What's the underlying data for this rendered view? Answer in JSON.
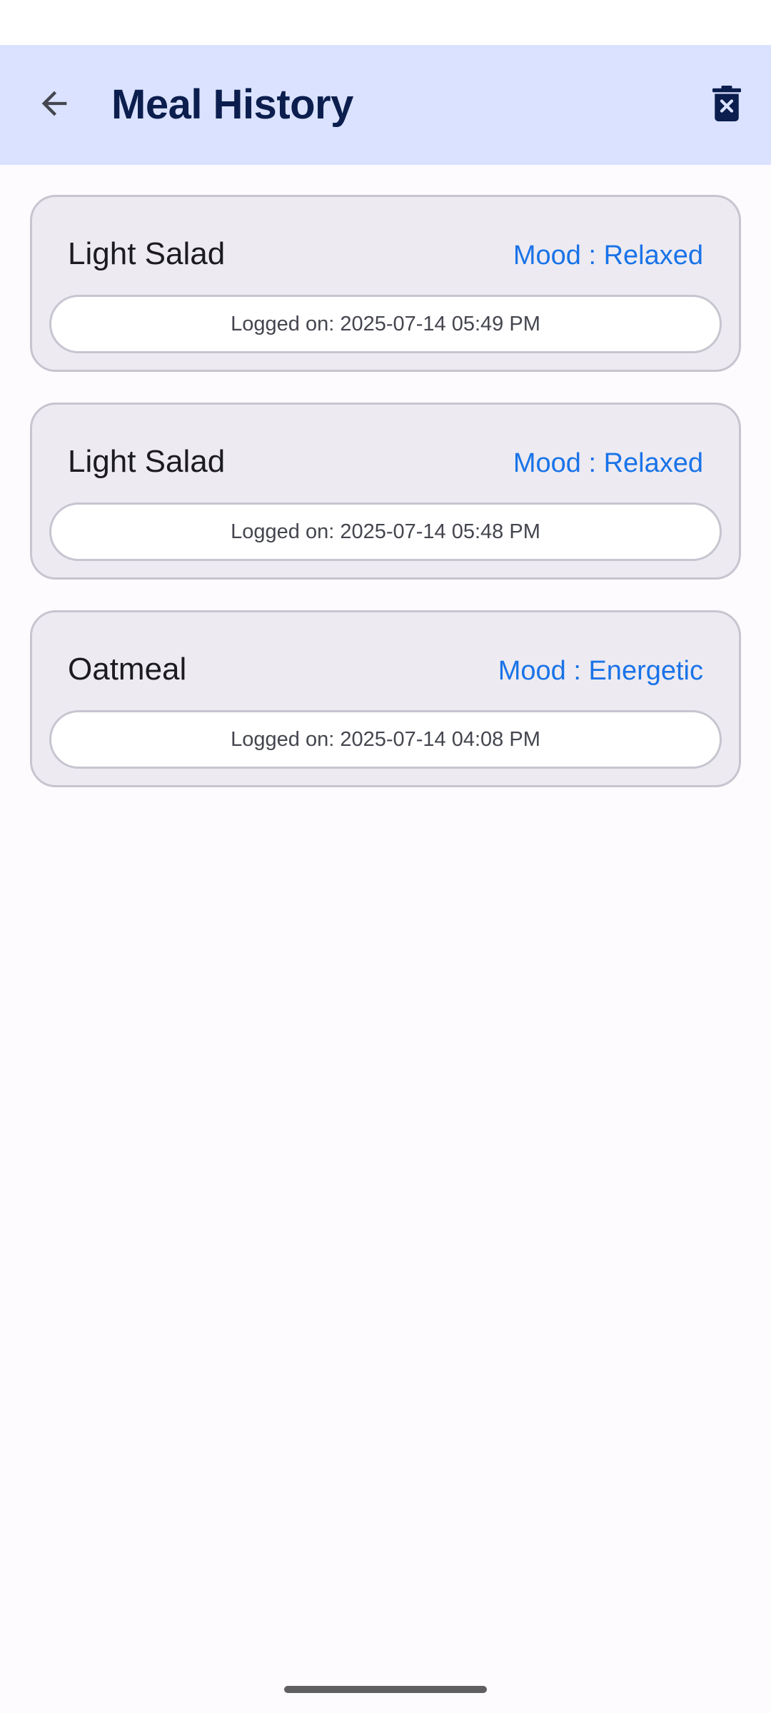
{
  "app_bar": {
    "title": "Meal History",
    "back_icon": "arrow-back-icon",
    "delete_icon": "delete-forever-icon",
    "background": "#dae2ff",
    "title_color": "#0b1e4d"
  },
  "meals": [
    {
      "name": "Light Salad",
      "mood": "Mood : Relaxed",
      "logged": "Logged on: 2025-07-14 05:49 PM"
    },
    {
      "name": "Light Salad",
      "mood": "Mood : Relaxed",
      "logged": "Logged on: 2025-07-14 05:48 PM"
    },
    {
      "name": "Oatmeal",
      "mood": "Mood : Energetic",
      "logged": "Logged on: 2025-07-14 04:08 PM"
    }
  ],
  "colors": {
    "mood_text": "#1a73e8",
    "card_background": "#edebf1",
    "card_border": "#c6c5d0"
  }
}
